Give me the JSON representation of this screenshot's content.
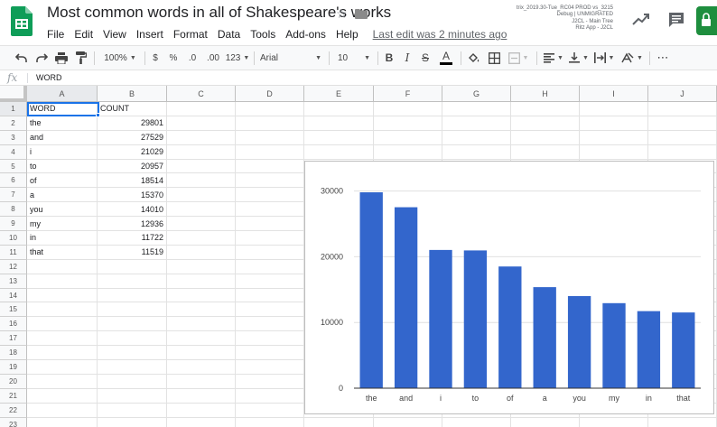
{
  "document": {
    "title": "Most common words in all of Shakespeare's works",
    "last_edit": "Last edit was 2 minutes ago",
    "build_info": [
      "trix_2019.30-Tue_RC04 PROD vs_3215",
      "Debug | UNMIGRATED",
      "J2CL - Main Tree",
      "Ritz App - J2CL"
    ],
    "icons": [
      "sheets-logo-icon",
      "star-icon",
      "folder-icon",
      "trend-icon",
      "comment-icon",
      "lock-icon"
    ]
  },
  "menu": [
    "File",
    "Edit",
    "View",
    "Insert",
    "Format",
    "Data",
    "Tools",
    "Add-ons",
    "Help"
  ],
  "toolbar": {
    "zoom": "100%",
    "currency": "$",
    "percent": "%",
    "decimal_decrease": ".0",
    "decimal_increase": ".00",
    "more_formats": "123",
    "font": "Arial",
    "font_size": "10",
    "bold": "B",
    "italic": "I",
    "strikethrough": "S",
    "text_color_letter": "A",
    "more": "⋯",
    "text_color": "#000000"
  },
  "formula_bar": {
    "fx": "fx",
    "value": "WORD"
  },
  "grid": {
    "selected_cell": "A1",
    "columns": [
      "A",
      "B",
      "C",
      "D",
      "E",
      "F",
      "G",
      "H",
      "I",
      "J"
    ],
    "row_numbers": [
      "1",
      "2",
      "3",
      "4",
      "5",
      "6",
      "7",
      "8",
      "9",
      "10",
      "11",
      "12",
      "13",
      "14",
      "15",
      "16",
      "17",
      "18",
      "19",
      "20",
      "21",
      "22",
      "23"
    ],
    "header": [
      "WORD",
      "COUNT"
    ],
    "rows": [
      [
        "the",
        "29801"
      ],
      [
        "and",
        "27529"
      ],
      [
        "i",
        "21029"
      ],
      [
        "to",
        "20957"
      ],
      [
        "of",
        "18514"
      ],
      [
        "a",
        "15370"
      ],
      [
        "you",
        "14010"
      ],
      [
        "my",
        "12936"
      ],
      [
        "in",
        "11722"
      ],
      [
        "that",
        "11519"
      ]
    ]
  },
  "chart_data": {
    "type": "bar",
    "title": "",
    "xlabel": "",
    "ylabel": "",
    "categories": [
      "the",
      "and",
      "i",
      "to",
      "of",
      "a",
      "you",
      "my",
      "in",
      "that"
    ],
    "series": [
      {
        "values": [
          29801,
          27529,
          21029,
          20957,
          18514,
          15370,
          14010,
          12936,
          11722,
          11519
        ]
      }
    ],
    "ylim": [
      0,
      32000
    ],
    "yticks": [
      0,
      10000,
      20000,
      30000
    ],
    "ytick_labels": [
      "0",
      "10000",
      "20000",
      "30000"
    ],
    "grid": true,
    "legend": "none",
    "bar_color": "#3366cc"
  }
}
